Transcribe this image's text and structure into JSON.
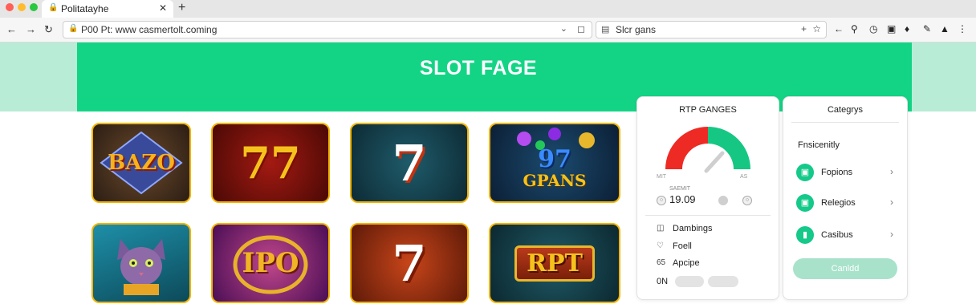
{
  "browser": {
    "tab_title": "Politatayhe",
    "url": "P00 Pt: www casmertolt.coming",
    "search_text": "Slcr gans"
  },
  "page": {
    "hero_title": "SLOT FAGE",
    "accent_color": "#13d485",
    "tiles": [
      {
        "label": "BAZO"
      },
      {
        "label": "77"
      },
      {
        "label": "7"
      },
      {
        "label": "97",
        "sub": "GPANS"
      },
      {
        "label": "",
        "icon": "cat-character-icon"
      },
      {
        "label": "IPO"
      },
      {
        "label": "7"
      },
      {
        "label": "RPT"
      }
    ]
  },
  "rtp_panel": {
    "title": "RTP GANGES",
    "gauge_min": "MIT",
    "gauge_max": "AS",
    "small_label": "SAEMIT",
    "value": "19.09",
    "items": [
      {
        "icon": "cards-icon",
        "label": "Dambings"
      },
      {
        "icon": "heart-icon",
        "label": "Foell"
      },
      {
        "icon": "number-icon",
        "icon_text": "65",
        "label": "Apcipe"
      }
    ],
    "bottom_label": "0N"
  },
  "category_panel": {
    "title": "Categrys",
    "subtitle": "Fnsicenitly",
    "items": [
      {
        "label": "Fopions"
      },
      {
        "label": "Relegios"
      },
      {
        "label": "Casibus"
      }
    ],
    "button_label": "Canldd"
  }
}
